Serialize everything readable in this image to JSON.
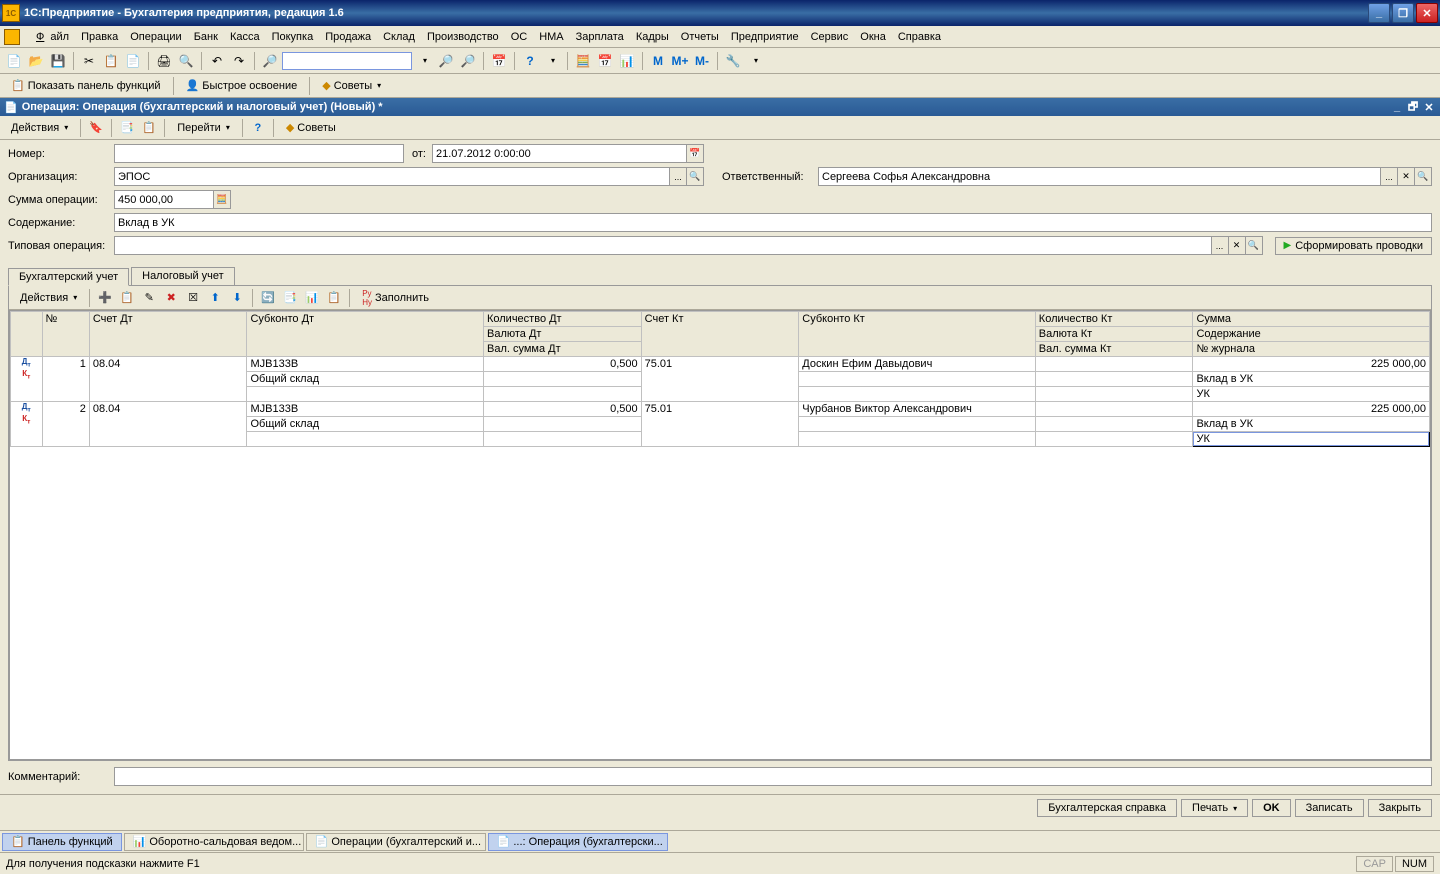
{
  "titlebar": {
    "app": "1С:Предприятие",
    "title": " - Бухгалтерия предприятия, редакция 1.6"
  },
  "menu": [
    "Файл",
    "Правка",
    "Операции",
    "Банк",
    "Касса",
    "Покупка",
    "Продажа",
    "Склад",
    "Производство",
    "ОС",
    "НМА",
    "Зарплата",
    "Кадры",
    "Отчеты",
    "Предприятие",
    "Сервис",
    "Окна",
    "Справка"
  ],
  "toolbar2": {
    "panel": "Показать панель функций",
    "quick": "Быстрое освоение",
    "tips": "Советы"
  },
  "toolbar_m": {
    "m": "M",
    "mp": "M+",
    "mm": "M-"
  },
  "doc": {
    "hdr": "Операция: Операция (бухгалтерский и налоговый учет) (Новый) *",
    "actions": "Действия",
    "go": "Перейти",
    "tips": "Советы",
    "lbl_num": "Номер:",
    "lbl_from": "от:",
    "lbl_org": "Организация:",
    "lbl_resp": "Ответственный:",
    "lbl_sum": "Сумма операции:",
    "lbl_cont": "Содержание:",
    "lbl_typ": "Типовая операция:",
    "lbl_comm": "Комментарий:",
    "num": "",
    "from": "21.07.2012  0:00:00",
    "org": "ЭПОС",
    "resp": "Сергеева Софья Александровна",
    "sum": "450 000,00",
    "cont": "Вклад в УК",
    "typ": "",
    "comm": "",
    "gen": "Сформировать проводки"
  },
  "tabs": {
    "buh": "Бухгалтерский учет",
    "nal": "Налоговый учет"
  },
  "tabtb": {
    "actions": "Действия",
    "fill": "Заполнить"
  },
  "grid": {
    "hdr": {
      "n": "№",
      "sdt": "Счет Дт",
      "sbdt": "Субконто Дт",
      "qdt": "Количество Дт",
      "vdt": "Валюта Дт",
      "vsdt": "Вал. сумма Дт",
      "skt": "Счет Кт",
      "sbkt": "Субконто Кт",
      "qkt": "Количество Кт",
      "vkt": "Валюта Кт",
      "vskt": "Вал. сумма Кт",
      "sum": "Сумма",
      "cont": "Содержание",
      "jn": "№ журнала"
    },
    "rows": [
      {
        "n": "1",
        "sdt": "08.04",
        "sbdt1": "МJВ133В",
        "sbdt2": "Общий склад",
        "qdt": "0,500",
        "skt": "75.01",
        "sbkt1": "Доскин Ефим Давыдович",
        "sum": "225 000,00",
        "cont": "Вклад в УК",
        "jn": "УК"
      },
      {
        "n": "2",
        "sdt": "08.04",
        "sbdt1": "МJВ133В",
        "sbdt2": "Общий склад",
        "qdt": "0,500",
        "skt": "75.01",
        "sbkt1": "Чурбанов Виктор Александрович",
        "sum": "225 000,00",
        "cont": "Вклад в УК",
        "jn": "УК"
      }
    ]
  },
  "footer": {
    "spravka": "Бухгалтерская справка",
    "print": "Печать",
    "ok": "OK",
    "save": "Записать",
    "close": "Закрыть"
  },
  "taskbar": [
    {
      "t": "Панель функций",
      "active": true
    },
    {
      "t": "Оборотно-сальдовая ведом...",
      "active": false
    },
    {
      "t": "Операции (бухгалтерский и...",
      "active": false
    },
    {
      "t": "...: Операция (бухгалтерски...",
      "active": true
    }
  ],
  "status": {
    "hint": "Для получения подсказки нажмите F1",
    "cap": "CAP",
    "num": "NUM"
  }
}
